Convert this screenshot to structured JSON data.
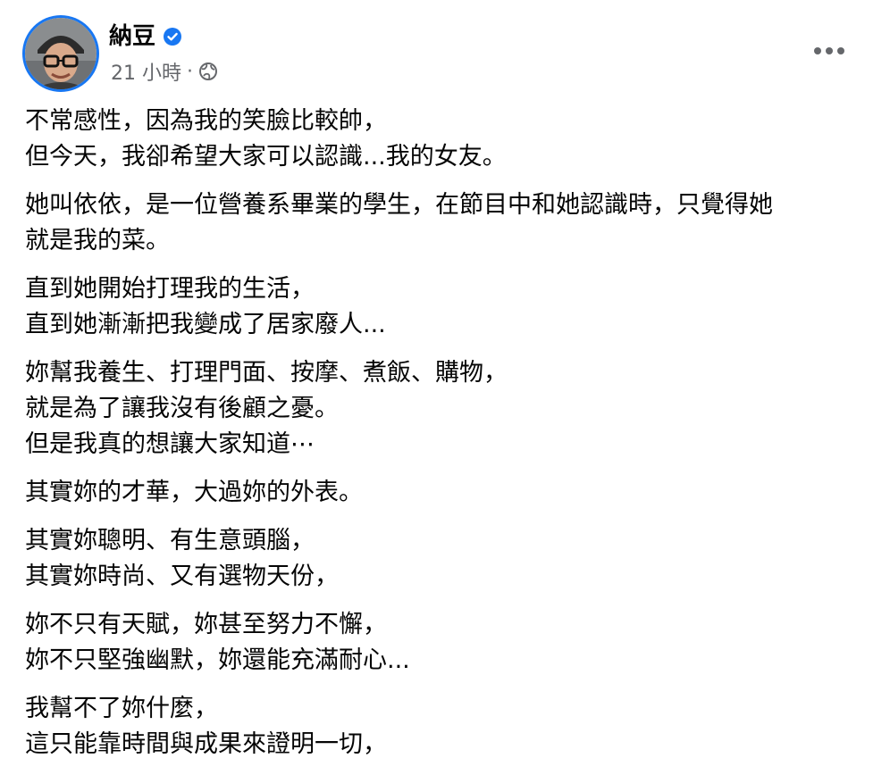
{
  "post": {
    "author": {
      "name": "納豆",
      "verified": true
    },
    "timestamp": "21 小時",
    "separator": "·",
    "privacy_icon": "globe-icon",
    "more_icon": "more-options-icon",
    "body": {
      "paragraphs": [
        [
          "不常感性，因為我的笑臉比較帥，",
          "但今天，我卻希望大家可以認識...我的女友。"
        ],
        [
          "她叫依依，是一位營養系畢業的學生，在節目中和她認識時，只覺得她",
          "就是我的菜。"
        ],
        [
          "直到她開始打理我的生活，",
          "直到她漸漸把我變成了居家廢人..."
        ],
        [
          "妳幫我養生、打理門面、按摩、煮飯、購物，",
          "就是為了讓我沒有後顧之憂。",
          "但是我真的想讓大家知道⋯"
        ],
        [
          "其實妳的才華，大過妳的外表。"
        ],
        [
          "其實妳聰明、有生意頭腦，",
          "其實妳時尚、又有選物天份，"
        ],
        [
          "妳不只有天賦，妳甚至努力不懈，",
          "妳不只堅強幽默，妳還能充滿耐心..."
        ],
        [
          "我幫不了妳什麼，",
          "這只能靠時間與成果來證明一切，"
        ]
      ]
    }
  },
  "colors": {
    "text_primary": "#050505",
    "text_secondary": "#65676b",
    "verified_blue": "#1877f2",
    "avatar_ring": "#1877f2"
  }
}
